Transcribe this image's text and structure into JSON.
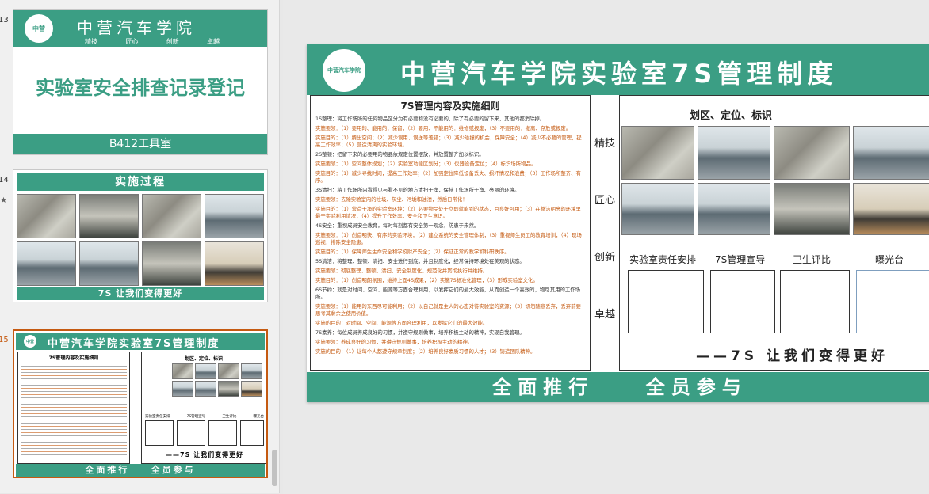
{
  "thumbnails": [
    {
      "number": "13",
      "school": "中营汽车学院",
      "mottos": [
        "精技",
        "匠心",
        "创新",
        "卓越"
      ],
      "title": "实验室安全排查记录登记",
      "room": "B412工具室"
    },
    {
      "number": "14",
      "star": "★",
      "header": "实施过程",
      "footer": "7S 让我们变得更好"
    },
    {
      "number": "15",
      "header": "中营汽车学院实验室7S管理制度",
      "section": "7S管理内容及实施细则",
      "zone": "划区、定位、标识",
      "labels": [
        "实验室责任安排",
        "7S管理宣导",
        "卫生评比",
        "曝光台"
      ],
      "slogan": "——7S 让我们变得更好",
      "footer": "全面推行    全员参与"
    }
  ],
  "slide": {
    "title": "中营汽车学院实验室7S管理制度",
    "logo_text": "中营汽车学院",
    "section_title": "7S管理内容及实施细则",
    "details": [
      {
        "cls": "bk",
        "text": "1S整理：将工作场所的任何物品区分为有必要和没有必要的，除了有必要的留下来，其他的都消除掉。"
      },
      {
        "cls": "cn",
        "text": "实施要领：（1）要用的、能用的：保留；（2）要用、不能用的：维修或报废；（3）不要用的：撤离、存放或报废。"
      },
      {
        "cls": "cn",
        "text": "实施目的：（1）腾出空间；（2）减少误用、误送等差错；（3）减少碰撞的机会，保障安全；（4）减少不必要的管理，提高工作效率；（5）营造清爽的实验环境。"
      },
      {
        "cls": "bk",
        "text": "2S整顿：把留下来的必要用的物品依规定位置摆放，并放置整齐加以标识。"
      },
      {
        "cls": "cn",
        "text": "实施要领：（1）空间整体规划；（2）实验室功能区划分；（3）仪器设备定位；（4）标识场所物品。"
      },
      {
        "cls": "cn",
        "text": "实施目的：（1）减少寻找时间，提高工作效率；（2）加强定位降低设备丢失、损坏情况和浪费；（3）工作场所整齐、有序。"
      },
      {
        "cls": "bk",
        "text": "3S清扫：将工作场所内看得见与看不见的地方清扫干净，保持工作场所干净、亮丽的环境。"
      },
      {
        "cls": "cn",
        "text": "实施要领：去除实验室内的垃圾、灰尘、污垢和油渍，然后日常化！"
      },
      {
        "cls": "cn",
        "text": "实施目的：（1）营造干净的实验室环境；（2）必要物品处于立即就能到的状态，且良好可用；（3）在整洁明亮的环境里最干实验利用情况；（4）提升工作效率，安全和卫生意识。"
      },
      {
        "cls": "bk",
        "text": "4S安全：重视成员安全教育，每时每刻都有安全第一观念，防患于未然。"
      },
      {
        "cls": "cn",
        "text": "实施要领：（1）创造明快、有序的实验环境；（2）建立系统的安全管理体制；（3）重视师生员工的教育培训；（4）现场巡视，排除安全隐患。"
      },
      {
        "cls": "cn",
        "text": "实施目的：（1）保障师生生命安全和学校财产安全；（2）保证正常的教学和科研秩序。"
      },
      {
        "cls": "bk",
        "text": "5S清洁：将整理、整顿、清扫、安全进行到底，并且制度化，经常保持环境处在美观的状态。"
      },
      {
        "cls": "cn",
        "text": "实施要领：彻底整理、整顿、清扫、安全制度化、规范化并贯彻执行并维持。"
      },
      {
        "cls": "cn",
        "text": "实施目的：（1）创造明朗氛围，维持上面4S成果；（2）实施7S标准化管理；（3）形成实验室文化。"
      },
      {
        "cls": "bk",
        "text": "6S节约：就是对时间、空间、能源等方面合理利用，以发挥它们的最大效能，从而创造一个高效的，物尽其用的工作场所。"
      },
      {
        "cls": "cn",
        "text": "实施要领：（1）能用的东西尽可能利用；（2）以自己就是主人的心态对待实验室的资源；（3）切勿随意丢弃，丢弃前要思考其剩余之使用价值。"
      },
      {
        "cls": "cn",
        "text": "实施的目的：对时间、空间、能源等方面合理利用，以发挥它们的最大效能。"
      },
      {
        "cls": "bk",
        "text": "7S素养：每位成员养成良好的习惯，并遵守规则做事，培养积极主动的精神，实现自我管理。"
      },
      {
        "cls": "cn",
        "text": "实施要领：养成良好的习惯，并遵守规则做事，培养积极主动的精神。"
      },
      {
        "cls": "cn",
        "text": "实施的目的：（1）让每个人都遵守规章制度；（2）培养良好素质习惯的人才；（3）铸造团队精神。"
      }
    ],
    "mottos": [
      "精技",
      "匠心",
      "创新",
      "卓越"
    ],
    "zone_title": "划区、定位、标识",
    "labels": [
      "实验室责任安排",
      "7S管理宣导",
      "卫生评比",
      "曝光台"
    ],
    "slogan": "——7S 让我们变得更好",
    "footer": "全面推行    全员参与"
  },
  "colors": {
    "accent": "#3b9e84",
    "text_red": "#c55a11",
    "active_border": "#c55a11"
  }
}
